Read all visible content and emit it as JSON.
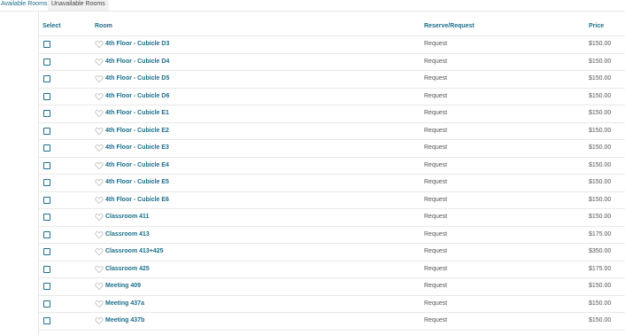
{
  "tabs": {
    "available": "Available Rooms",
    "unavailable": "Unavailable Rooms"
  },
  "table": {
    "headers": {
      "select": "Select",
      "room": "Room",
      "reserve": "Reserve/Request",
      "price": "Price"
    },
    "rows": [
      {
        "room": "4th Floor - Cubicle D3",
        "reserve": "Request",
        "price": "$150.00"
      },
      {
        "room": "4th Floor - Cubicle D4",
        "reserve": "Request",
        "price": "$150.00"
      },
      {
        "room": "4th Floor - Cubicle D5",
        "reserve": "Request",
        "price": "$150.00"
      },
      {
        "room": "4th Floor - Cubicle D6",
        "reserve": "Request",
        "price": "$150.00"
      },
      {
        "room": "4th Floor - Cubicle E1",
        "reserve": "Request",
        "price": "$150.00"
      },
      {
        "room": "4th Floor - Cubicle E2",
        "reserve": "Request",
        "price": "$150.00"
      },
      {
        "room": "4th Floor - Cubicle E3",
        "reserve": "Request",
        "price": "$150.00"
      },
      {
        "room": "4th Floor - Cubicle E4",
        "reserve": "Request",
        "price": "$150.00"
      },
      {
        "room": "4th Floor - Cubicle E5",
        "reserve": "Request",
        "price": "$150.00"
      },
      {
        "room": "4th Floor - Cubicle E6",
        "reserve": "Request",
        "price": "$150.00"
      },
      {
        "room": "Classroom 411",
        "reserve": "Request",
        "price": "$150.00"
      },
      {
        "room": "Classroom 413",
        "reserve": "Request",
        "price": "$175.00"
      },
      {
        "room": "Classroom 413+425",
        "reserve": "Request",
        "price": "$350.00"
      },
      {
        "room": "Classroom 425",
        "reserve": "Request",
        "price": "$175.00"
      },
      {
        "room": "Meeting 409",
        "reserve": "Request",
        "price": "$150.00"
      },
      {
        "room": "Meeting 437a",
        "reserve": "Request",
        "price": "$150.00"
      },
      {
        "room": "Meeting 437b",
        "reserve": "Request",
        "price": "$150.00"
      }
    ]
  },
  "icons": {
    "checkbox": "checkbox-icon",
    "favorite": "heart-icon"
  },
  "colors": {
    "accent": "#1a6e8a",
    "text": "#555555",
    "divider": "#e8e8e8"
  }
}
